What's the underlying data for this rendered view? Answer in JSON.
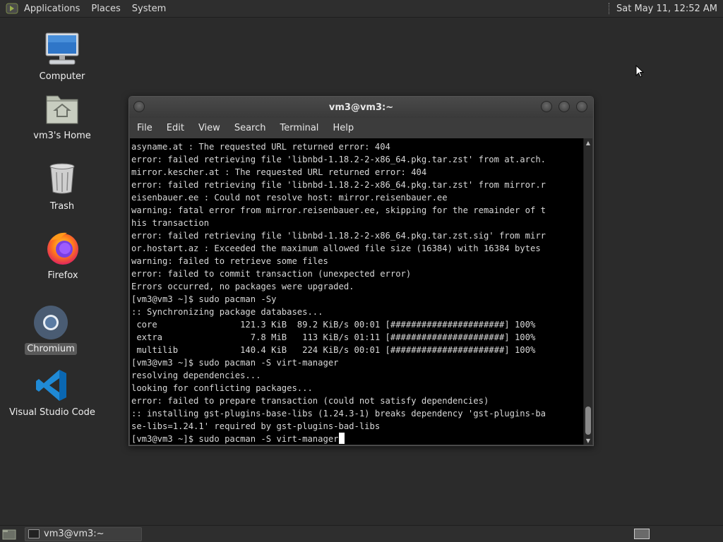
{
  "top_panel": {
    "menus": [
      "Applications",
      "Places",
      "System"
    ],
    "clock": "Sat May 11, 12:52 AM"
  },
  "desktop_icons": [
    {
      "label": "Computer",
      "icon": "computer-icon"
    },
    {
      "label": "vm3's Home",
      "icon": "home-folder-icon"
    },
    {
      "label": "Trash",
      "icon": "trash-icon"
    },
    {
      "label": "Firefox",
      "icon": "firefox-icon"
    },
    {
      "label": "Chromium",
      "icon": "chromium-icon",
      "selected": true
    },
    {
      "label": "Visual Studio Code",
      "icon": "vscode-icon"
    }
  ],
  "terminal": {
    "title": "vm3@vm3:~",
    "menu": [
      "File",
      "Edit",
      "View",
      "Search",
      "Terminal",
      "Help"
    ],
    "lines": [
      "asyname.at : The requested URL returned error: 404",
      "error: failed retrieving file 'libnbd-1.18.2-2-x86_64.pkg.tar.zst' from at.arch.",
      "mirror.kescher.at : The requested URL returned error: 404",
      "error: failed retrieving file 'libnbd-1.18.2-2-x86_64.pkg.tar.zst' from mirror.r",
      "eisenbauer.ee : Could not resolve host: mirror.reisenbauer.ee",
      "warning: fatal error from mirror.reisenbauer.ee, skipping for the remainder of t",
      "his transaction",
      "error: failed retrieving file 'libnbd-1.18.2-2-x86_64.pkg.tar.zst.sig' from mirr",
      "or.hostart.az : Exceeded the maximum allowed file size (16384) with 16384 bytes",
      "warning: failed to retrieve some files",
      "error: failed to commit transaction (unexpected error)",
      "Errors occurred, no packages were upgraded.",
      "[vm3@vm3 ~]$ sudo pacman -Sy",
      ":: Synchronizing package databases...",
      " core                121.3 KiB  89.2 KiB/s 00:01 [######################] 100%",
      " extra                 7.8 MiB   113 KiB/s 01:11 [######################] 100%",
      " multilib            140.4 KiB   224 KiB/s 00:01 [######################] 100%",
      "[vm3@vm3 ~]$ sudo pacman -S virt-manager",
      "resolving dependencies...",
      "looking for conflicting packages...",
      "error: failed to prepare transaction (could not satisfy dependencies)",
      ":: installing gst-plugins-base-libs (1.24.3-1) breaks dependency 'gst-plugins-ba",
      "se-libs=1.24.1' required by gst-plugins-bad-libs"
    ],
    "prompt_line": "[vm3@vm3 ~]$ sudo pacman -S virt-manager"
  },
  "bottom_panel": {
    "task_label": "vm3@vm3:~"
  }
}
